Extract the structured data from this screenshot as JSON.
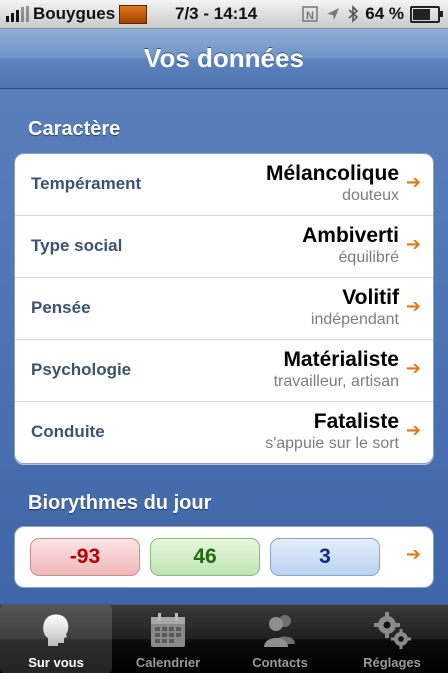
{
  "status_bar": {
    "carrier": "Bouygues",
    "datetime": "7/3 - 14:14",
    "battery": "64 %"
  },
  "navbar": {
    "title": "Vos données"
  },
  "caractere": {
    "title": "Caractère",
    "rows": [
      {
        "label": "Tempérament",
        "value": "Mélancolique",
        "sub": "douteux"
      },
      {
        "label": "Type social",
        "value": "Ambiverti",
        "sub": "équilibré"
      },
      {
        "label": "Pensée",
        "value": "Volitif",
        "sub": "indépendant"
      },
      {
        "label": "Psychologie",
        "value": "Matérialiste",
        "sub": "travailleur, artisan"
      },
      {
        "label": "Conduite",
        "value": "Fataliste",
        "sub": "s'appuie sur le sort"
      }
    ]
  },
  "biorythmes": {
    "title": "Biorythmes du jour",
    "values": [
      "-93",
      "46",
      "3"
    ],
    "colors": [
      "#b00000",
      "#1f6a12",
      "#0b2a8a"
    ]
  },
  "tabbar": {
    "tabs": [
      {
        "label": "Sur vous",
        "icon": "head-icon",
        "active": true
      },
      {
        "label": "Calendrier",
        "icon": "calendar-icon",
        "active": false
      },
      {
        "label": "Contacts",
        "icon": "contacts-icon",
        "active": false
      },
      {
        "label": "Réglages",
        "icon": "gears-icon",
        "active": false
      }
    ]
  },
  "arrow_glyph": "➔"
}
